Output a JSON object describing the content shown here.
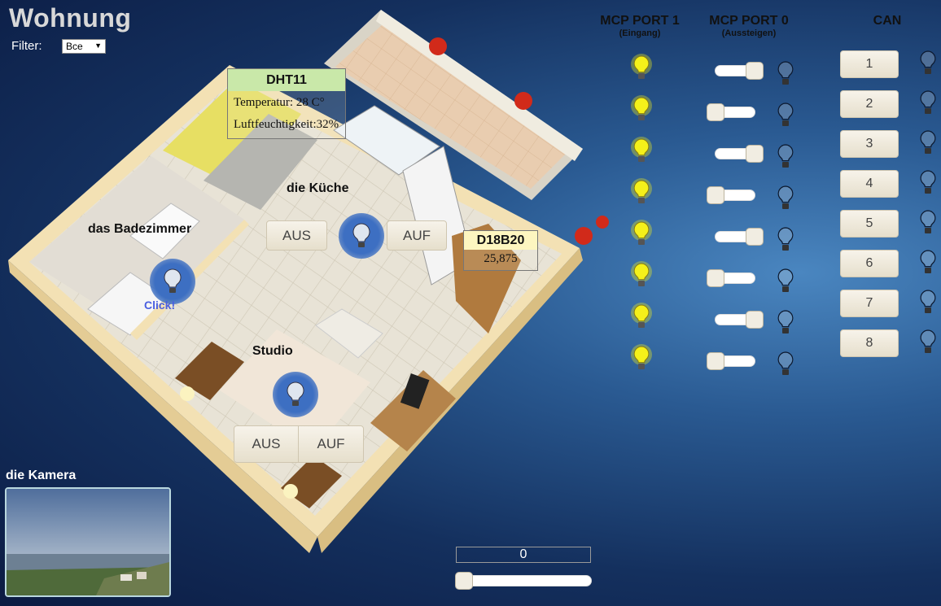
{
  "header": {
    "title": "Wohnung",
    "filter_label": "Filter:",
    "filter_value": "Все"
  },
  "rooms": {
    "kitchen": {
      "label": "die Küche",
      "off_label": "AUS",
      "on_label": "AUF"
    },
    "bathroom": {
      "label": "das Badezimmer",
      "click_hint": "Click!"
    },
    "studio": {
      "label": "Studio",
      "off_label": "AUS",
      "on_label": "AUF"
    }
  },
  "sensors": {
    "dht11": {
      "name": "DHT11",
      "temperature": "Temperatur: 28 C°",
      "humidity": "Luftfeuchtigkeit:32%"
    },
    "d18b20": {
      "name": "D18B20",
      "value": "25,875"
    }
  },
  "mcp_port1": {
    "title": "MCP PORT 1",
    "subtitle": "(Eingang)",
    "lamps": [
      true,
      true,
      true,
      true,
      true,
      true,
      true,
      true
    ]
  },
  "mcp_port0": {
    "title": "MCP PORT 0",
    "subtitle": "(Aussteigen)",
    "toggles": [
      1,
      0,
      1,
      0,
      1,
      0,
      1,
      0
    ]
  },
  "can": {
    "title": "CAN",
    "buttons": [
      "1",
      "2",
      "3",
      "4",
      "5",
      "6",
      "7",
      "8"
    ]
  },
  "camera": {
    "label": "die Kamera"
  },
  "bottom": {
    "value": "0",
    "slider_value": 0
  },
  "colors": {
    "accent_blue": "#3d6fc2",
    "lamp_yellow": "#f4f01a",
    "click_text": "#4a5fe0"
  }
}
